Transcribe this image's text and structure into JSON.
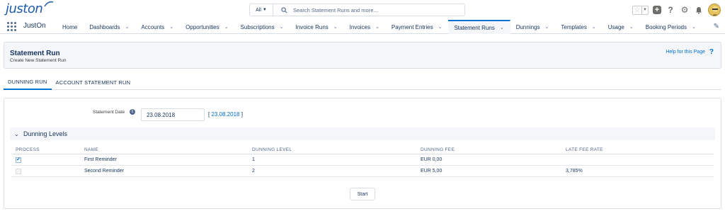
{
  "header": {
    "logo_text": "juston",
    "search": {
      "scope": "All",
      "placeholder": "Search Statement Runs and more..."
    },
    "icons": [
      "star-icon",
      "chevron-down-icon",
      "plus-icon",
      "question-icon",
      "gear-icon",
      "bell-icon",
      "avatar"
    ]
  },
  "nav": {
    "app_name": "JustOn",
    "items": [
      {
        "label": "Home",
        "dropdown": false,
        "active": false
      },
      {
        "label": "Dashboards",
        "dropdown": true,
        "active": false
      },
      {
        "label": "Accounts",
        "dropdown": true,
        "active": false
      },
      {
        "label": "Opportunities",
        "dropdown": true,
        "active": false
      },
      {
        "label": "Subscriptions",
        "dropdown": true,
        "active": false
      },
      {
        "label": "Invoice Runs",
        "dropdown": true,
        "active": false
      },
      {
        "label": "Invoices",
        "dropdown": true,
        "active": false
      },
      {
        "label": "Payment Entries",
        "dropdown": true,
        "active": false
      },
      {
        "label": "Statement Runs",
        "dropdown": true,
        "active": true
      },
      {
        "label": "Dunnings",
        "dropdown": true,
        "active": false
      },
      {
        "label": "Templates",
        "dropdown": true,
        "active": false
      },
      {
        "label": "Usage",
        "dropdown": true,
        "active": false
      },
      {
        "label": "Booking Periods",
        "dropdown": true,
        "active": false
      }
    ]
  },
  "page": {
    "title": "Statement Run",
    "subtitle": "Create New Statement Run",
    "help_label": "Help for this Page",
    "help_icon": "?"
  },
  "tabs": [
    {
      "label": "DUNNING RUN",
      "active": true
    },
    {
      "label": "ACCOUNT STATEMENT RUN",
      "active": false
    }
  ],
  "form": {
    "date_label": "Statement Date",
    "date_value": "23.08.2018",
    "date_link_open": "[",
    "date_link": "23.08.2018",
    "date_link_close": "]"
  },
  "section": {
    "title": "Dunning Levels"
  },
  "table": {
    "columns": [
      "PROCESS",
      "NAME",
      "DUNNING LEVEL",
      "DUNNING FEE",
      "LATE FEE RATE"
    ],
    "rows": [
      {
        "process": true,
        "name": "First Reminder",
        "level": "1",
        "fee": "EUR 0,00",
        "late_fee_rate": ""
      },
      {
        "process": false,
        "name": "Second Reminder",
        "level": "2",
        "fee": "EUR 5,00",
        "late_fee_rate": "3,785%"
      }
    ]
  },
  "actions": {
    "start_label": "Start"
  },
  "colors": {
    "brand_blue": "#1e5aa8",
    "link_blue": "#0070d2",
    "text_navy": "#16325c",
    "header_gray": "#f4f6f9"
  }
}
